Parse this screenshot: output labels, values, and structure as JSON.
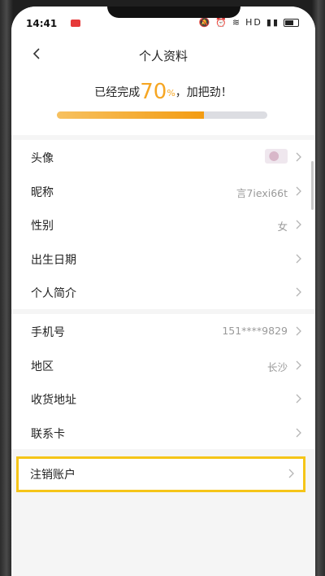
{
  "status_bar": {
    "time": "14:41",
    "indicators": "HD"
  },
  "header": {
    "title": "个人资料",
    "back_icon": "chevron-left-icon"
  },
  "progress": {
    "prefix": "已经完成",
    "percent_number": "70",
    "percent_sign": "%",
    "suffix": "，加把劲！",
    "fraction": 0.7,
    "fill_color_start": "#f7c160",
    "fill_color_end": "#f39c12",
    "track_color": "#dcdde2"
  },
  "section1": [
    {
      "label": "头像",
      "value": ""
    },
    {
      "label": "昵称",
      "value": "言7iexi66t"
    },
    {
      "label": "性别",
      "value": "女"
    },
    {
      "label": "出生日期",
      "value": ""
    },
    {
      "label": "个人简介",
      "value": ""
    }
  ],
  "section2": [
    {
      "label": "手机号",
      "value": "151****9829"
    },
    {
      "label": "地区",
      "value": "长沙"
    },
    {
      "label": "收货地址",
      "value": ""
    },
    {
      "label": "联系卡",
      "value": ""
    }
  ],
  "deactivate": {
    "label": "注销账户",
    "highlight_color": "#f5c518"
  },
  "colors": {
    "accent": "#f6a623",
    "background": "#f5f5f5"
  }
}
